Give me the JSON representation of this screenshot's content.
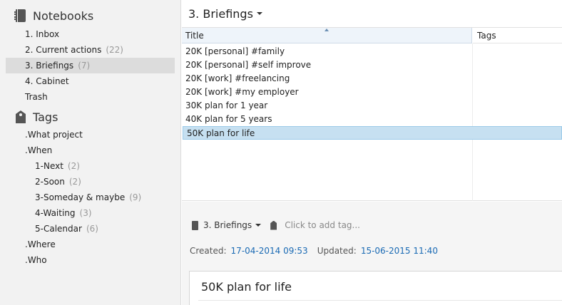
{
  "sidebar": {
    "notebooks_label": "Notebooks",
    "notebooks": [
      {
        "label": "1. Inbox",
        "count": ""
      },
      {
        "label": "2. Current actions",
        "count": "(22)"
      },
      {
        "label": "3. Briefings",
        "count": "(7)"
      },
      {
        "label": "4. Cabinet",
        "count": ""
      },
      {
        "label": "Trash",
        "count": ""
      }
    ],
    "tags_label": "Tags",
    "tags": [
      {
        "label": ".What project",
        "count": ""
      },
      {
        "label": ".When",
        "count": ""
      },
      {
        "label": "1-Next",
        "count": "(2)"
      },
      {
        "label": "2-Soon",
        "count": "(2)"
      },
      {
        "label": "3-Someday & maybe",
        "count": "(9)"
      },
      {
        "label": "4-Waiting",
        "count": "(3)"
      },
      {
        "label": "5-Calendar",
        "count": "(6)"
      },
      {
        "label": ".Where",
        "count": ""
      },
      {
        "label": ".Who",
        "count": ""
      }
    ]
  },
  "main": {
    "notebook_title": "3. Briefings",
    "columns": {
      "title": "Title",
      "tags": "Tags"
    },
    "notes": [
      "20K [personal] #family",
      "20K [personal] #self improve",
      "20K [work] #freelancing",
      "20K [work] #my employer",
      "30K plan for 1 year",
      "40K plan for 5 years",
      "50K plan for life"
    ],
    "selected_index": 6
  },
  "meta": {
    "notebook": "3. Briefings",
    "add_tag_placeholder": "Click to add tag...",
    "created_label": "Created:",
    "created_value": "17-04-2014 09:53",
    "updated_label": "Updated:",
    "updated_value": "15-06-2015 11:40"
  },
  "editor": {
    "note_title": "50K plan for life"
  },
  "colors": {
    "selection": "#c6e0f1",
    "link": "#1a6ab4",
    "sidebar_bg": "#f2f2f2"
  }
}
